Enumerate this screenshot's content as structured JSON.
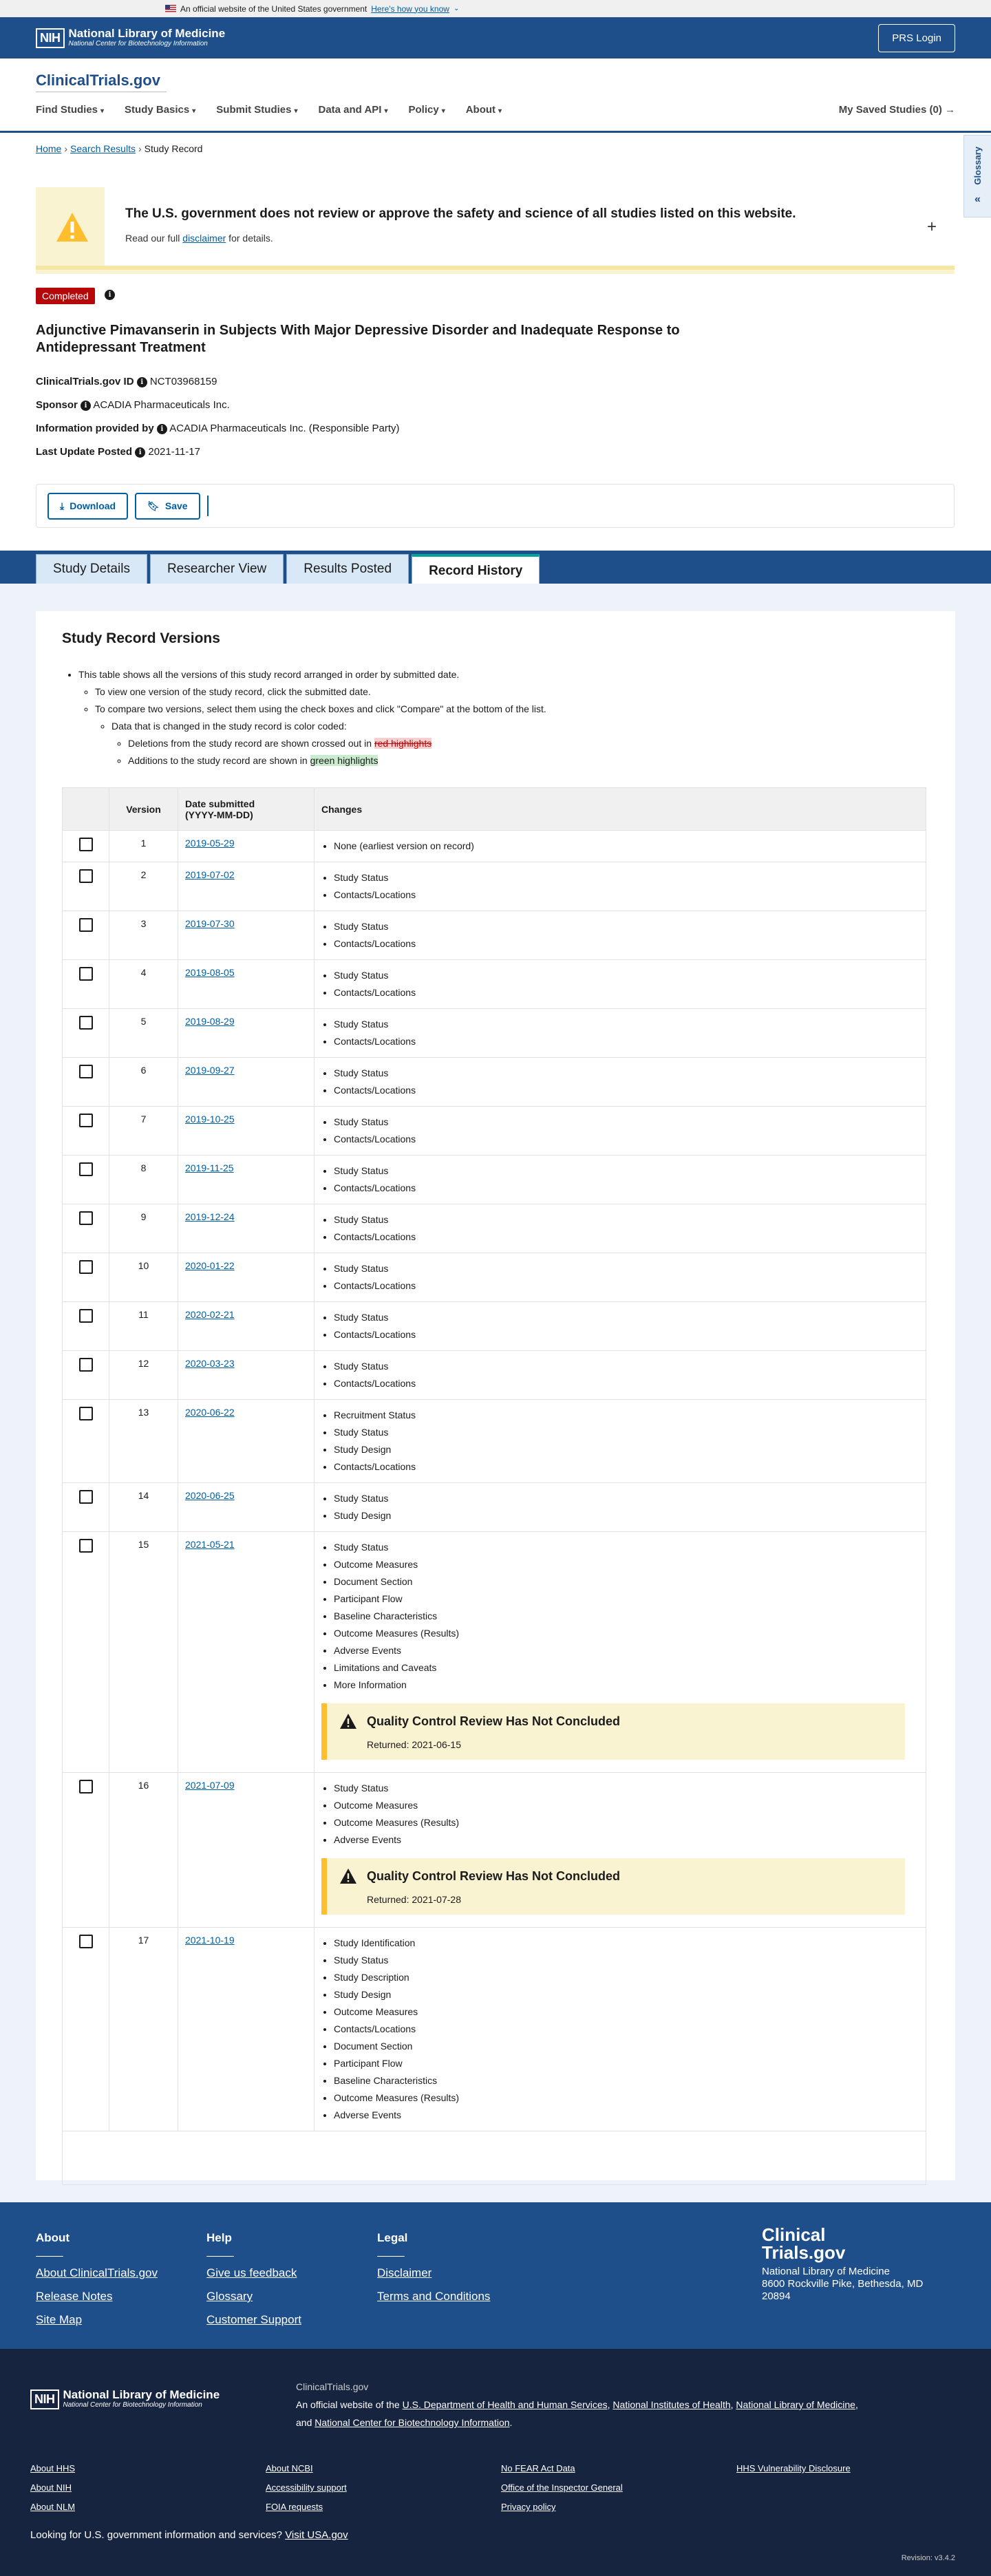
{
  "gov_banner": {
    "text": "An official website of the United States government",
    "link": "Here's how you know"
  },
  "nlm": {
    "nih": "NIH",
    "title": "National Library of Medicine",
    "subtitle": "National Center for Biotechnology Information",
    "prs_login": "PRS Login"
  },
  "header": {
    "logo_a": "Clinical",
    "logo_b": "Trials.gov",
    "nav": [
      "Find Studies",
      "Study Basics",
      "Submit Studies",
      "Data and API",
      "Policy",
      "About"
    ],
    "saved": "My Saved Studies (0)"
  },
  "glossary": "Glossary",
  "breadcrumb": {
    "home": "Home",
    "results": "Search Results",
    "current": "Study Record"
  },
  "alert": {
    "title": "The U.S. government does not review or approve the safety and science of all studies listed on this website.",
    "text_a": "Read our full ",
    "link": "disclaimer",
    "text_b": " for details."
  },
  "study": {
    "status": "Completed",
    "title": "Adjunctive Pimavanserin in Subjects With Major Depressive Disorder and Inadequate Response to Antidepressant Treatment",
    "id_label": "ClinicalTrials.gov ID",
    "id": "NCT03968159",
    "sponsor_label": "Sponsor",
    "sponsor": "ACADIA Pharmaceuticals Inc.",
    "info_label": "Information provided by",
    "info": "ACADIA Pharmaceuticals Inc. (Responsible Party)",
    "updated_label": "Last Update Posted",
    "updated": "2021-11-17"
  },
  "toolbar": {
    "download": "Download",
    "save": "Save"
  },
  "tabs": [
    "Study Details",
    "Researcher View",
    "Results Posted",
    "Record History"
  ],
  "versions": {
    "heading": "Study Record Versions",
    "intro1": "This table shows all the versions of this study record arranged in order by submitted date.",
    "intro2": "To view one version of the study record, click the submitted date.",
    "intro3": "To compare two versions, select them using the check boxes and click \"Compare\" at the bottom of the list.",
    "intro4": "Data that is changed in the study record is color coded:",
    "intro5": "Deletions from the study record are shown crossed out in ",
    "red": "red highlights",
    "intro6": "Additions to the study record are shown in ",
    "green": "green highlights",
    "col_version": "Version",
    "col_date": "Date submitted\n(YYYY-MM-DD)",
    "col_changes": "Changes",
    "qc_title": "Quality Control Review Has Not Concluded",
    "rows": [
      {
        "v": "1",
        "date": "2019-05-29",
        "changes": [
          "None (earliest version on record)"
        ]
      },
      {
        "v": "2",
        "date": "2019-07-02",
        "changes": [
          "Study Status",
          "Contacts/Locations"
        ]
      },
      {
        "v": "3",
        "date": "2019-07-30",
        "changes": [
          "Study Status",
          "Contacts/Locations"
        ]
      },
      {
        "v": "4",
        "date": "2019-08-05",
        "changes": [
          "Study Status",
          "Contacts/Locations"
        ]
      },
      {
        "v": "5",
        "date": "2019-08-29",
        "changes": [
          "Study Status",
          "Contacts/Locations"
        ]
      },
      {
        "v": "6",
        "date": "2019-09-27",
        "changes": [
          "Study Status",
          "Contacts/Locations"
        ]
      },
      {
        "v": "7",
        "date": "2019-10-25",
        "changes": [
          "Study Status",
          "Contacts/Locations"
        ]
      },
      {
        "v": "8",
        "date": "2019-11-25",
        "changes": [
          "Study Status",
          "Contacts/Locations"
        ]
      },
      {
        "v": "9",
        "date": "2019-12-24",
        "changes": [
          "Study Status",
          "Contacts/Locations"
        ]
      },
      {
        "v": "10",
        "date": "2020-01-22",
        "changes": [
          "Study Status",
          "Contacts/Locations"
        ]
      },
      {
        "v": "11",
        "date": "2020-02-21",
        "changes": [
          "Study Status",
          "Contacts/Locations"
        ]
      },
      {
        "v": "12",
        "date": "2020-03-23",
        "changes": [
          "Study Status",
          "Contacts/Locations"
        ]
      },
      {
        "v": "13",
        "date": "2020-06-22",
        "changes": [
          "Recruitment Status",
          "Study Status",
          "Study Design",
          "Contacts/Locations"
        ]
      },
      {
        "v": "14",
        "date": "2020-06-25",
        "changes": [
          "Study Status",
          "Study Design"
        ]
      },
      {
        "v": "15",
        "date": "2021-05-21",
        "changes": [
          "Study Status",
          "Outcome Measures",
          "Document Section",
          "Participant Flow",
          "Baseline Characteristics",
          "Outcome Measures (Results)",
          "Adverse Events",
          "Limitations and Caveats",
          "More Information"
        ],
        "qc": "Returned: 2021-06-15"
      },
      {
        "v": "16",
        "date": "2021-07-09",
        "changes": [
          "Study Status",
          "Outcome Measures",
          "Outcome Measures (Results)",
          "Adverse Events"
        ],
        "qc": "Returned: 2021-07-28"
      },
      {
        "v": "17",
        "date": "2021-10-19",
        "changes": [
          "Study Identification",
          "Study Status",
          "Study Description",
          "Study Design",
          "Outcome Measures",
          "Contacts/Locations",
          "Document Section",
          "Participant Flow",
          "Baseline Characteristics",
          "Outcome Measures (Results)",
          "Adverse Events"
        ]
      }
    ]
  },
  "footer": {
    "about": {
      "title": "About",
      "links": [
        "About ClinicalTrials.gov",
        "Release Notes",
        "Site Map"
      ]
    },
    "help": {
      "title": "Help",
      "links": [
        "Give us feedback",
        "Glossary",
        "Customer Support"
      ]
    },
    "legal": {
      "title": "Legal",
      "links": [
        "Disclaimer",
        "Terms and Conditions"
      ]
    },
    "logo_a": "Clinical",
    "logo_b": "Trials.gov",
    "address": [
      "National Library of Medicine",
      "8600 Rockville Pike, Bethesda, MD",
      "20894"
    ]
  },
  "footer2": {
    "site": "ClinicalTrials.gov",
    "official_a": "An official website of the ",
    "hhs": "U.S. Department of Health and Human Services",
    "nih": "National Institutes of Health",
    "nlm": "National Library of Medicine",
    "ncbi": "National Center for Biotechnology Information",
    "col1": [
      "About HHS",
      "About NIH",
      "About NLM"
    ],
    "col2": [
      "About NCBI",
      "Accessibility support",
      "FOIA requests"
    ],
    "col3": [
      "No FEAR Act Data",
      "Office of the Inspector General",
      "Privacy policy"
    ],
    "col4": [
      "HHS Vulnerability Disclosure"
    ],
    "usa_text": "Looking for U.S. government information and services?",
    "usa_link": "Visit USA.gov",
    "revision": "Revision: v3.4.2"
  }
}
